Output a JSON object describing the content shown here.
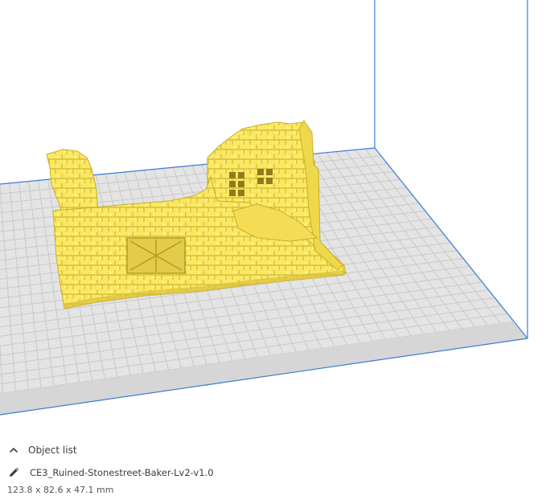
{
  "viewport": {
    "build_volume_edge_color": "#3a7fd5",
    "plate_color": "#e4e4e4",
    "grid_color": "#c9c9c9",
    "model_color": "#f9e45e",
    "model_shadow_color": "#c9b12c"
  },
  "object_panel": {
    "toggle_icon": "chevron-up-icon",
    "object_list_label": "Object list",
    "edit_icon": "pencil-icon",
    "object_name": "CE3_Ruined-Stonestreet-Baker-Lv2-v1.0",
    "object_dimensions": "123.8 x 82.6 x 47.1 mm"
  }
}
